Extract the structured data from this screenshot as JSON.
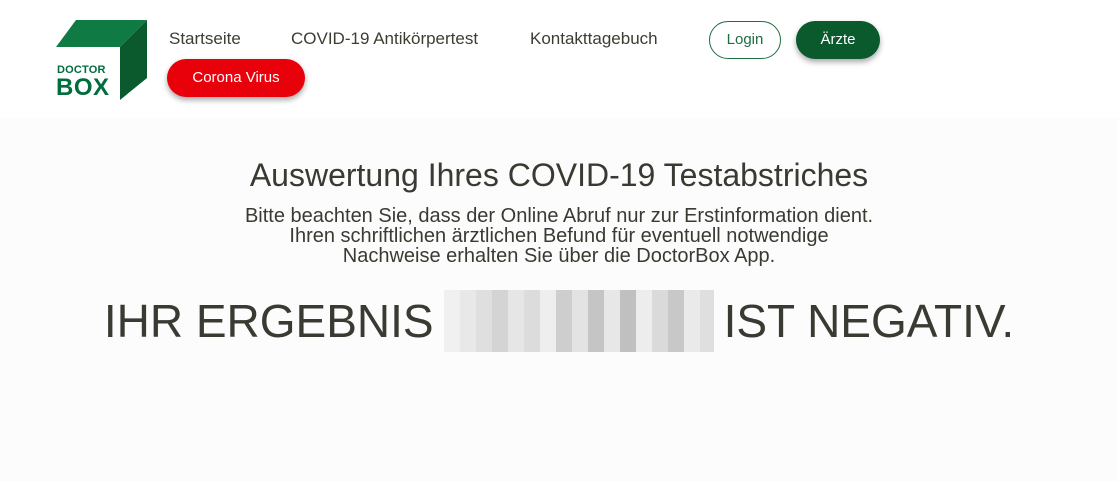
{
  "logo": {
    "line1": "DOCTOR",
    "line2": "BOX",
    "brand_color": "#006d3c"
  },
  "nav": {
    "items": [
      {
        "label": "Startseite"
      },
      {
        "label": "COVID-19 Antikörpertest"
      },
      {
        "label": "Kontakttagebuch"
      }
    ],
    "login_label": "Login",
    "aerzte_label": "Ärzte",
    "corona_label": "Corona Virus"
  },
  "colors": {
    "primary_green": "#0a5a2d",
    "corona_red": "#e8000b",
    "text": "#3a3a33"
  },
  "main": {
    "title": "Auswertung Ihres COVID-19 Testabstriches",
    "notice_lines": [
      "Bitte beachten Sie, dass der Online Abruf nur zur Erstinformation dient.",
      "Ihren schriftlichen ärztlichen Befund für eventuell notwendige",
      "Nachweise erhalten Sie über die DoctorBox App."
    ],
    "result_prefix": "IHR ERGEBNIS",
    "result_suffix": "IST NEGATIV."
  }
}
